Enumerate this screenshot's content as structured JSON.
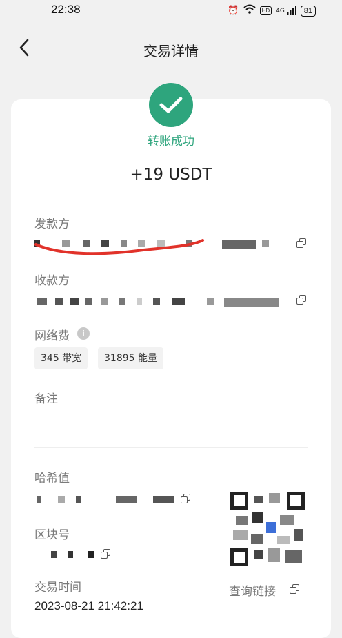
{
  "status_bar": {
    "time": "22:38",
    "network": "4G",
    "hd_badge": "HD",
    "battery": "81"
  },
  "nav": {
    "back_icon": "chevron-left-icon",
    "title": "交易详情"
  },
  "transaction": {
    "status_icon": "check-circle-icon",
    "status_label": "转账成功",
    "status_color": "#2ea57d",
    "amount": "+19 USDT",
    "sender_label": "发款方",
    "recipient_label": "收款方",
    "fee_label": "网络费",
    "fee_info_icon": "i",
    "bandwidth": "345 带宽",
    "energy": "31895 能量",
    "memo_label": "备注",
    "hash_label": "哈希值",
    "block_label": "区块号",
    "time_label": "交易时间",
    "time_value": "2023-08-21 21:42:21",
    "query_link_label": "查询链接"
  }
}
